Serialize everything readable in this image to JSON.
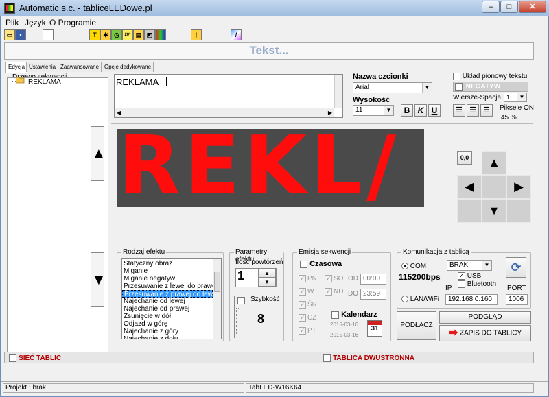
{
  "window": {
    "title": "Automatic s.c. - tabliceLEDowe.pl",
    "minimize": "–",
    "maximize": "□",
    "close": "✕"
  },
  "menu": [
    "Plik",
    "Język",
    "O Programie"
  ],
  "toolbar_icons": [
    "new-file-icon",
    "save-icon",
    "blank-icon",
    "text-tool-icon",
    "effect-icon",
    "clock-icon",
    "temperature-icon",
    "date-icon",
    "image-icon",
    "color-icon",
    "insert-icon",
    "paint-icon"
  ],
  "preview_title": "Tekst...",
  "tabs": [
    "Edycja",
    "Ustawienia",
    "Zaawansowane",
    "Opcje dedykowane"
  ],
  "tree": {
    "label": "Drzewo sekwencji",
    "items": [
      {
        "label": "REKLAMA"
      }
    ]
  },
  "editor": {
    "text": "REKLAMA"
  },
  "font": {
    "name_label": "Nazwa czcionki",
    "name_value": "Arial",
    "size_label": "Wysokość",
    "size_value": "11",
    "bold": "B",
    "italic": "K",
    "underline": "U"
  },
  "options": {
    "vertical_label": "Układ pionowy tekstu",
    "negative_label": "NEGATYW",
    "row_spacing_label": "Wiersze-Spacja",
    "row_spacing_value": "1",
    "pixels_on_label": "Piksele ON",
    "pixels_on_value": "45 %"
  },
  "led_preview": {
    "text": "REKL/",
    "color": "#ff0d0d",
    "background": "#4a4a4a"
  },
  "dpad": {
    "origin": "0,0",
    "up": "▲",
    "down": "▼",
    "left": "◀",
    "right": "▶"
  },
  "effects": {
    "label": "Rodzaj efektu",
    "items": [
      "Statyczny obraz",
      "Miganie",
      "Miganie negatyw",
      "Przesuwanie z lewej do prawej",
      "Przesuwanie z prawej do lewej",
      "Najechanie od lewej",
      "Najechanie od prawej",
      "Zsunięcie w dół",
      "Odjazd w górę",
      "Najechanie z góry",
      "Najechanie z dołu"
    ],
    "selected_index": 4
  },
  "params": {
    "label": "Parametry efektu",
    "repeat_label": "Ilość powtórzeń",
    "repeat_value": "1",
    "speed_label": "Szybkość",
    "speed_value": "8"
  },
  "emission": {
    "label": "Emisja sekwencji",
    "timed_label": "Czasowa",
    "days": [
      {
        "left": "PN",
        "right": "SO"
      },
      {
        "left": "WT",
        "right": "ND"
      },
      {
        "left": "ŚR",
        "right": ""
      },
      {
        "left": "CZ",
        "right": ""
      },
      {
        "left": "PT",
        "right": ""
      }
    ],
    "from_label": "OD",
    "from_value": "00:00",
    "to_label": "DO",
    "to_value": "23:59",
    "calendar_label": "Kalendarz",
    "date_from": "2015-03-16",
    "date_to": "2015-03-16",
    "calendar_icon_day": "31"
  },
  "communication": {
    "label": "Komunikacja z tablicą",
    "com_label": "COM",
    "com_value": "BRAK",
    "baud": "115200bps",
    "usb_label": "USB",
    "bluetooth_label": "Bluetooth",
    "lan_label": "LAN/WiFi",
    "ip_label": "IP",
    "ip_value": "192.168.0.160",
    "port_label": "PORT",
    "port_value": "1006"
  },
  "buttons": {
    "connect": "PODŁĄCZ",
    "preview": "PODGLĄD",
    "write": "ZAPIS DO TABLICY"
  },
  "bottom": {
    "network_label": "SIEĆ TABLIC",
    "double_sided_label": "TABLICA DWUSTRONNA"
  },
  "status": {
    "project": "Projekt : brak",
    "model": "TabLED-W16K64"
  }
}
